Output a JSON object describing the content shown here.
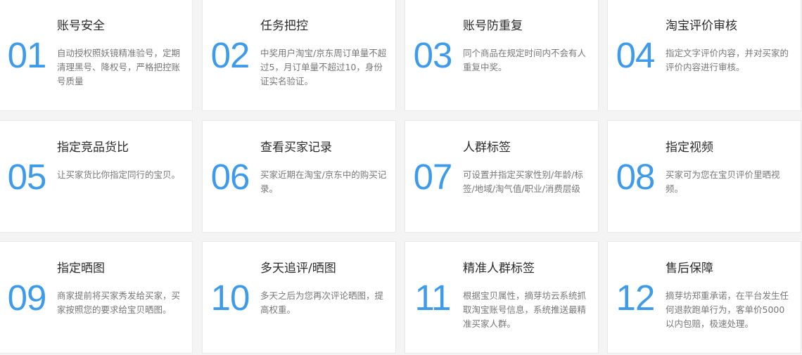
{
  "features": [
    {
      "num": "01",
      "title": "账号安全",
      "desc": "自动授权照妖镜精准验号，定期清理黑号、降权号，严格把控账号质量"
    },
    {
      "num": "02",
      "title": "任务把控",
      "desc": "中奖用户淘宝/京东周订单量不超过5，月订单量不超过10，身份证实名验证。"
    },
    {
      "num": "03",
      "title": "账号防重复",
      "desc": "同个商品在规定时间内不会有人重复中奖。"
    },
    {
      "num": "04",
      "title": "淘宝评价审核",
      "desc": "指定文字评价内容，并对买家的评价内容进行审核。"
    },
    {
      "num": "05",
      "title": "指定竞品货比",
      "desc": "让买家货比你指定同行的宝贝。"
    },
    {
      "num": "06",
      "title": "查看买家记录",
      "desc": "买家近期在淘宝/京东中的购买记录。"
    },
    {
      "num": "07",
      "title": "人群标签",
      "desc": "可设置并指定买家性别/年龄/标签/地域/淘气值/职业/消费层级"
    },
    {
      "num": "08",
      "title": "指定视频",
      "desc": "买家可为您在宝贝评价里晒视频。"
    },
    {
      "num": "09",
      "title": "指定晒图",
      "desc": "商家提前将买家秀发给买家，买家按照您的要求给宝贝晒图。"
    },
    {
      "num": "10",
      "title": "多天追评/晒图",
      "desc": "多天之后为您再次评论晒图，提高权重。"
    },
    {
      "num": "11",
      "title": "精准人群标签",
      "desc": "根据宝贝属性，摘芽坊云系统抓取淘宝账号信息，系统推送最精准买家人群。"
    },
    {
      "num": "12",
      "title": "售后保障",
      "desc": "摘芽坊郑重承诺，在平台发生任何退款跑单行为，客单价5000以内包赔，极速处理。"
    }
  ],
  "colors": {
    "accent": "#3d9be9",
    "title": "#2b2b2b",
    "desc": "#777777",
    "card_bg": "#ffffff",
    "page_bg": "#f4f4f4"
  }
}
